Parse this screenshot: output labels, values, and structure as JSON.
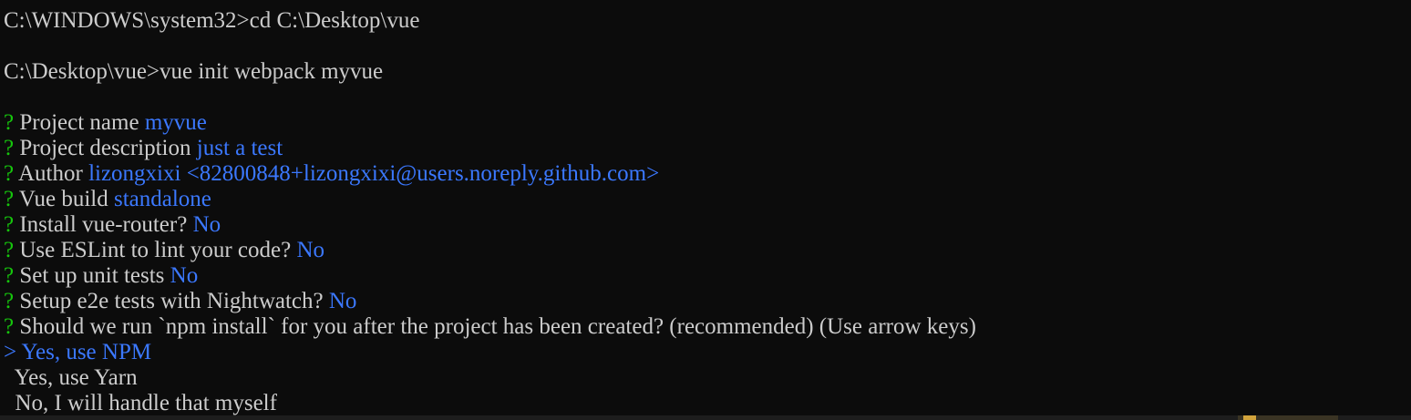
{
  "console": {
    "cmd1": {
      "prompt": "C:\\WINDOWS\\system32>",
      "command": "cd C:\\Desktop\\vue"
    },
    "cmd2": {
      "prompt": "C:\\Desktop\\vue>",
      "command": "vue init webpack myvue"
    },
    "questions": [
      {
        "mark": "?",
        "label": "Project name ",
        "answer": "myvue"
      },
      {
        "mark": "?",
        "label": "Project description ",
        "answer": "just a test"
      },
      {
        "mark": "?",
        "label": "Author ",
        "answer": "lizongxixi <82800848+lizongxixi@users.noreply.github.com>"
      },
      {
        "mark": "?",
        "label": "Vue build ",
        "answer": "standalone"
      },
      {
        "mark": "?",
        "label": "Install vue-router? ",
        "answer": "No"
      },
      {
        "mark": "?",
        "label": "Use ESLint to lint your code? ",
        "answer": "No"
      },
      {
        "mark": "?",
        "label": "Set up unit tests ",
        "answer": "No"
      },
      {
        "mark": "?",
        "label": "Setup e2e tests with Nightwatch? ",
        "answer": "No"
      }
    ],
    "final_question": {
      "mark": "?",
      "label": "Should we run `npm install` for you after the project has been created? (recommended) (Use arrow keys)"
    },
    "options": {
      "pointer": ">",
      "selected": "Yes, use NPM",
      "option2": "Yes, use Yarn",
      "option3": "No, I will handle that myself"
    }
  },
  "colors": {
    "background": "#0c0c0c",
    "text": "#cccccc",
    "question_mark": "#16c60c",
    "answer": "#3b78ff"
  }
}
